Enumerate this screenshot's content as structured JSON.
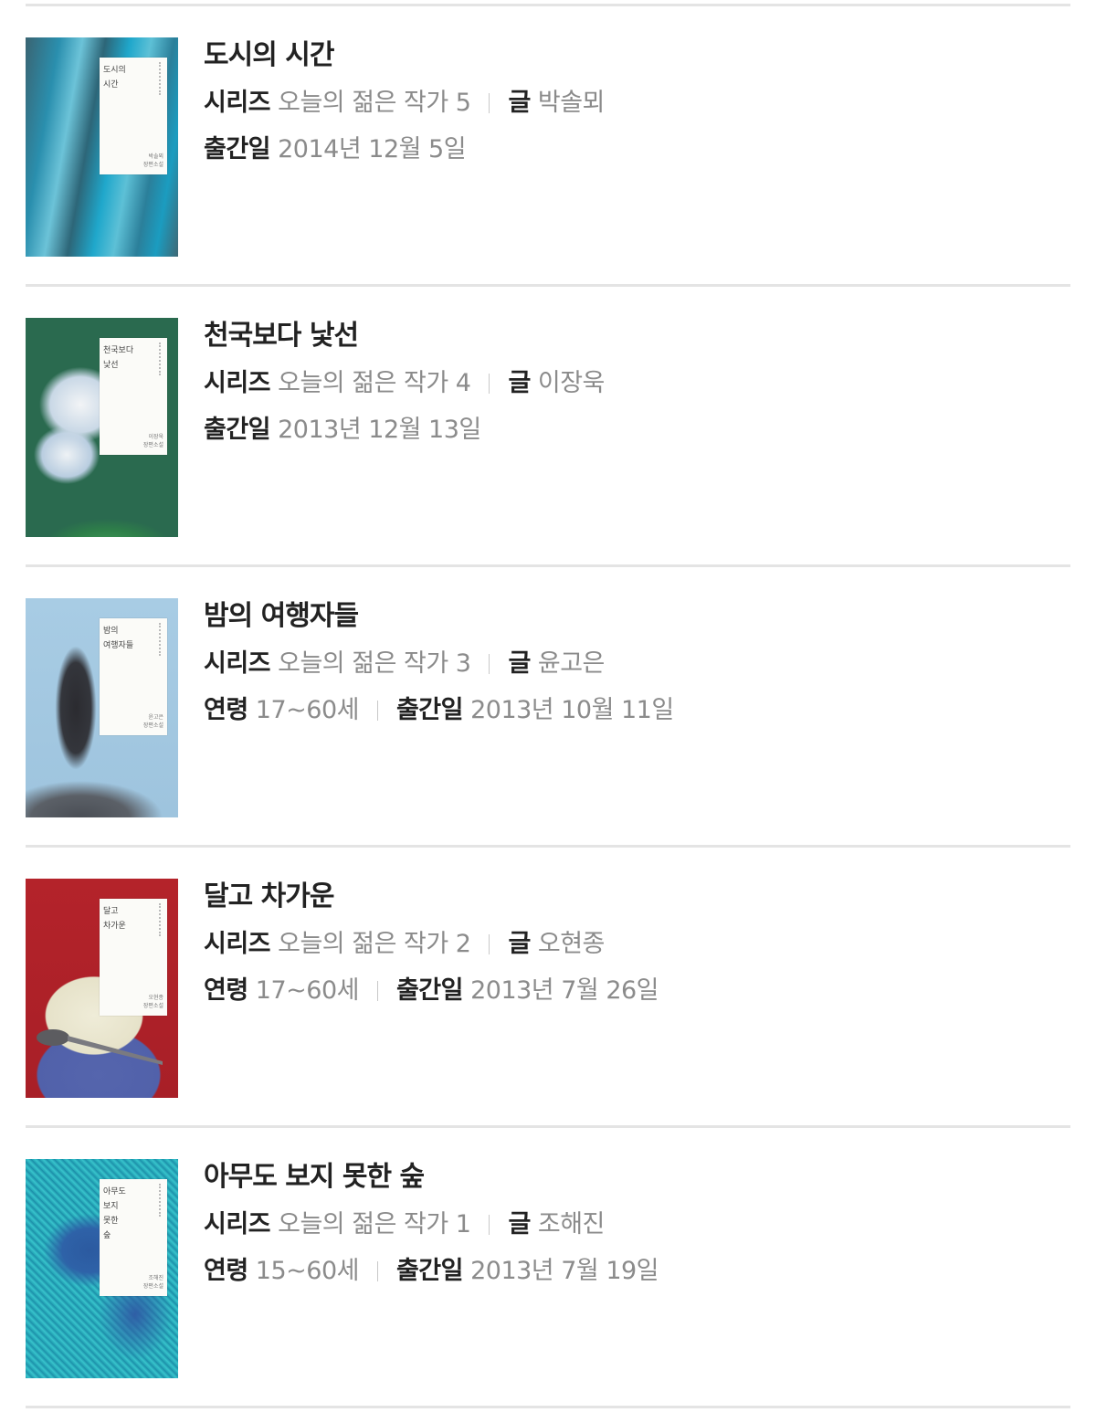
{
  "labels": {
    "series": "시리즈",
    "author": "글",
    "age": "연령",
    "release": "출간일"
  },
  "books": [
    {
      "title": "도시의 시간",
      "cover_text": "도시의\n시간",
      "cover_author": "박솔뫼\n장편소설",
      "cover_colors": [
        "#2f5a6b",
        "#1fa4c8",
        "#5fbfd5",
        "#375f6e"
      ],
      "series": "오늘의 젊은 작가 5",
      "author": "박솔뫼",
      "age": null,
      "release": "2014년 12월 5일"
    },
    {
      "title": "천국보다 낯선",
      "cover_text": "천국보다\n낯선",
      "cover_author": "이장욱\n장편소설",
      "cover_colors": [
        "#1d4f9a",
        "#2b63b0",
        "#dfe7ef",
        "#3a8a55"
      ],
      "series": "오늘의 젊은 작가 4",
      "author": "이장욱",
      "age": null,
      "release": "2013년 12월 13일"
    },
    {
      "title": "밤의 여행자들",
      "cover_text": "밤의\n여행자들",
      "cover_author": "윤고은\n장편소설",
      "cover_colors": [
        "#9fc6e0",
        "#b3d4ea",
        "#2a2a2e",
        "#555a60"
      ],
      "series": "오늘의 젊은 작가 3",
      "author": "윤고은",
      "age": "17~60세",
      "release": "2013년 10월 11일"
    },
    {
      "title": "달고 차가운",
      "cover_text": "달고\n차가운",
      "cover_author": "오현종\n장편소설",
      "cover_colors": [
        "#b3232a",
        "#e9e5cf",
        "#5b6bb0",
        "#9a9a9a"
      ],
      "series": "오늘의 젊은 작가 2",
      "author": "오현종",
      "age": "17~60세",
      "release": "2013년 7월 26일"
    },
    {
      "title": "아무도 보지 못한 숲",
      "cover_text": "아무도\n보지\n못한\n숲",
      "cover_author": "조해진\n장편소설",
      "cover_colors": [
        "#1f9bb0",
        "#2ab7c4",
        "#2c5aa0",
        "#3ecad0"
      ],
      "series": "오늘의 젊은 작가 1",
      "author": "조해진",
      "age": "15~60세",
      "release": "2013년 7월 19일"
    }
  ]
}
